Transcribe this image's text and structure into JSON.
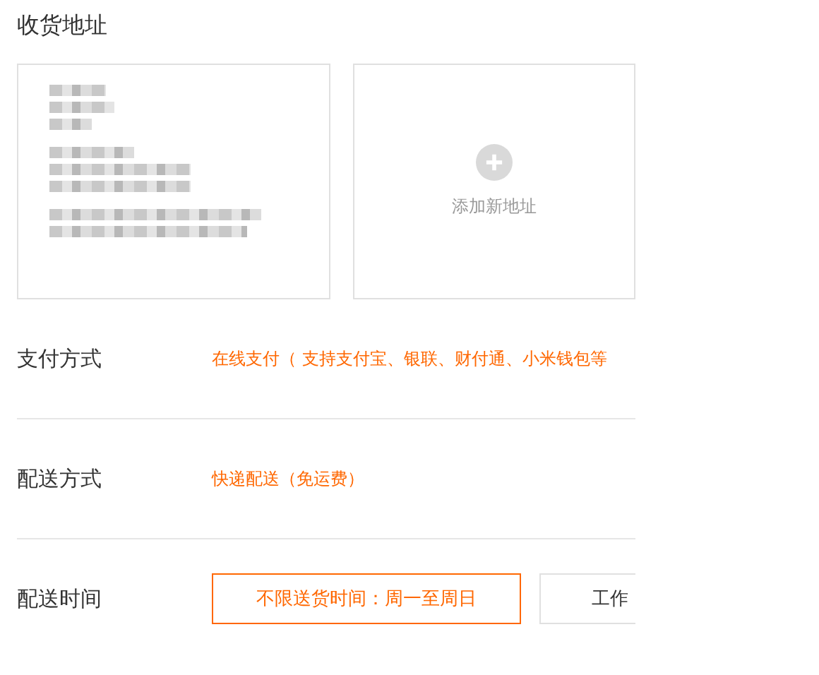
{
  "address_section": {
    "title": "收货地址",
    "cards": [
      {
        "kind": "address"
      },
      {
        "kind": "add",
        "label": "添加新地址"
      }
    ]
  },
  "rows": [
    {
      "label": "支付方式",
      "options": [
        {
          "text": "在线支付（ 支持支付宝、银联、财付通、小米钱包等",
          "selected": true,
          "kind": "text"
        }
      ]
    },
    {
      "label": "配送方式",
      "options": [
        {
          "text": "快递配送（免运费）",
          "selected": true,
          "kind": "text"
        }
      ]
    },
    {
      "label": "配送时间",
      "options": [
        {
          "text": "不限送货时间：周一至周日",
          "selected": true,
          "kind": "box"
        },
        {
          "text": "工作",
          "selected": false,
          "kind": "box"
        }
      ]
    }
  ]
}
